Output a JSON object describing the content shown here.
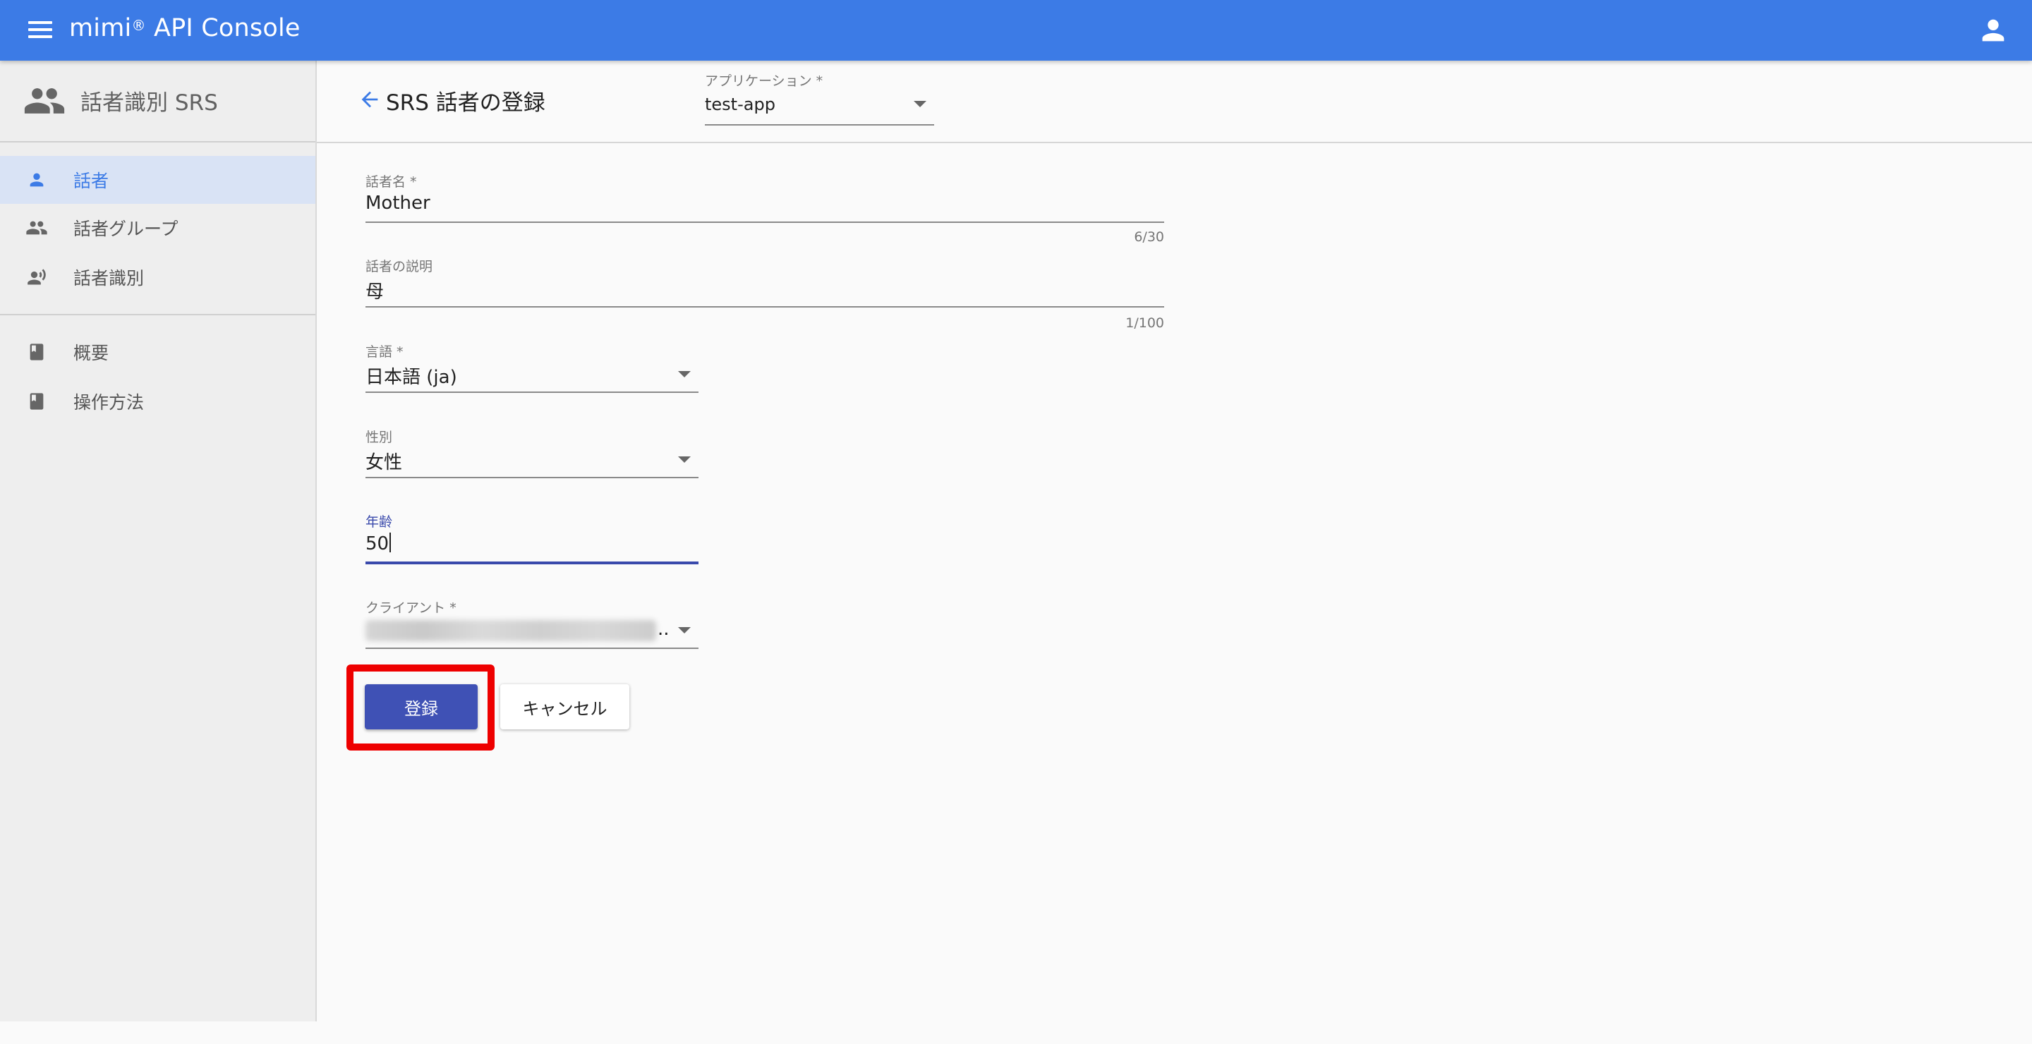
{
  "app_bar": {
    "title": "mimi",
    "title_mark": "®",
    "title_suffix": " API Console",
    "menu_icon": "menu-icon",
    "account_icon": "account-icon"
  },
  "sidebar": {
    "header": {
      "icon": "people-icon",
      "label": "話者識別 SRS"
    },
    "items": [
      {
        "label": "話者",
        "icon": "person-icon",
        "active": true
      },
      {
        "label": "話者グループ",
        "icon": "group-icon",
        "active": false
      },
      {
        "label": "話者識別",
        "icon": "voice-person-icon",
        "active": false
      },
      {
        "label": "概要",
        "icon": "book-icon",
        "active": false
      },
      {
        "label": "操作方法",
        "icon": "book-icon",
        "active": false
      }
    ]
  },
  "header": {
    "back_icon": "arrow-back-icon",
    "title": "SRS 話者の登録",
    "application_select": {
      "label": "アプリケーション *",
      "value": "test-app"
    }
  },
  "form": {
    "speaker_name": {
      "label": "話者名 *",
      "value": "Mother",
      "counter": "6/30"
    },
    "description": {
      "label": "話者の説明",
      "value": "母",
      "counter": "1/100"
    },
    "language": {
      "label": "言語 *",
      "value": "日本語 (ja)"
    },
    "gender": {
      "label": "性別",
      "value": "女性"
    },
    "age": {
      "label": "年齢",
      "value": "50"
    },
    "client": {
      "label": "クライアント *",
      "value_suffix": ".."
    }
  },
  "actions": {
    "register_label": "登録",
    "cancel_label": "キャンセル"
  },
  "colors": {
    "app_bar": "#3c7be6",
    "primary_button": "#3f51b5",
    "highlight": "#ee0000",
    "active_nav_bg": "#d9e3f5"
  }
}
